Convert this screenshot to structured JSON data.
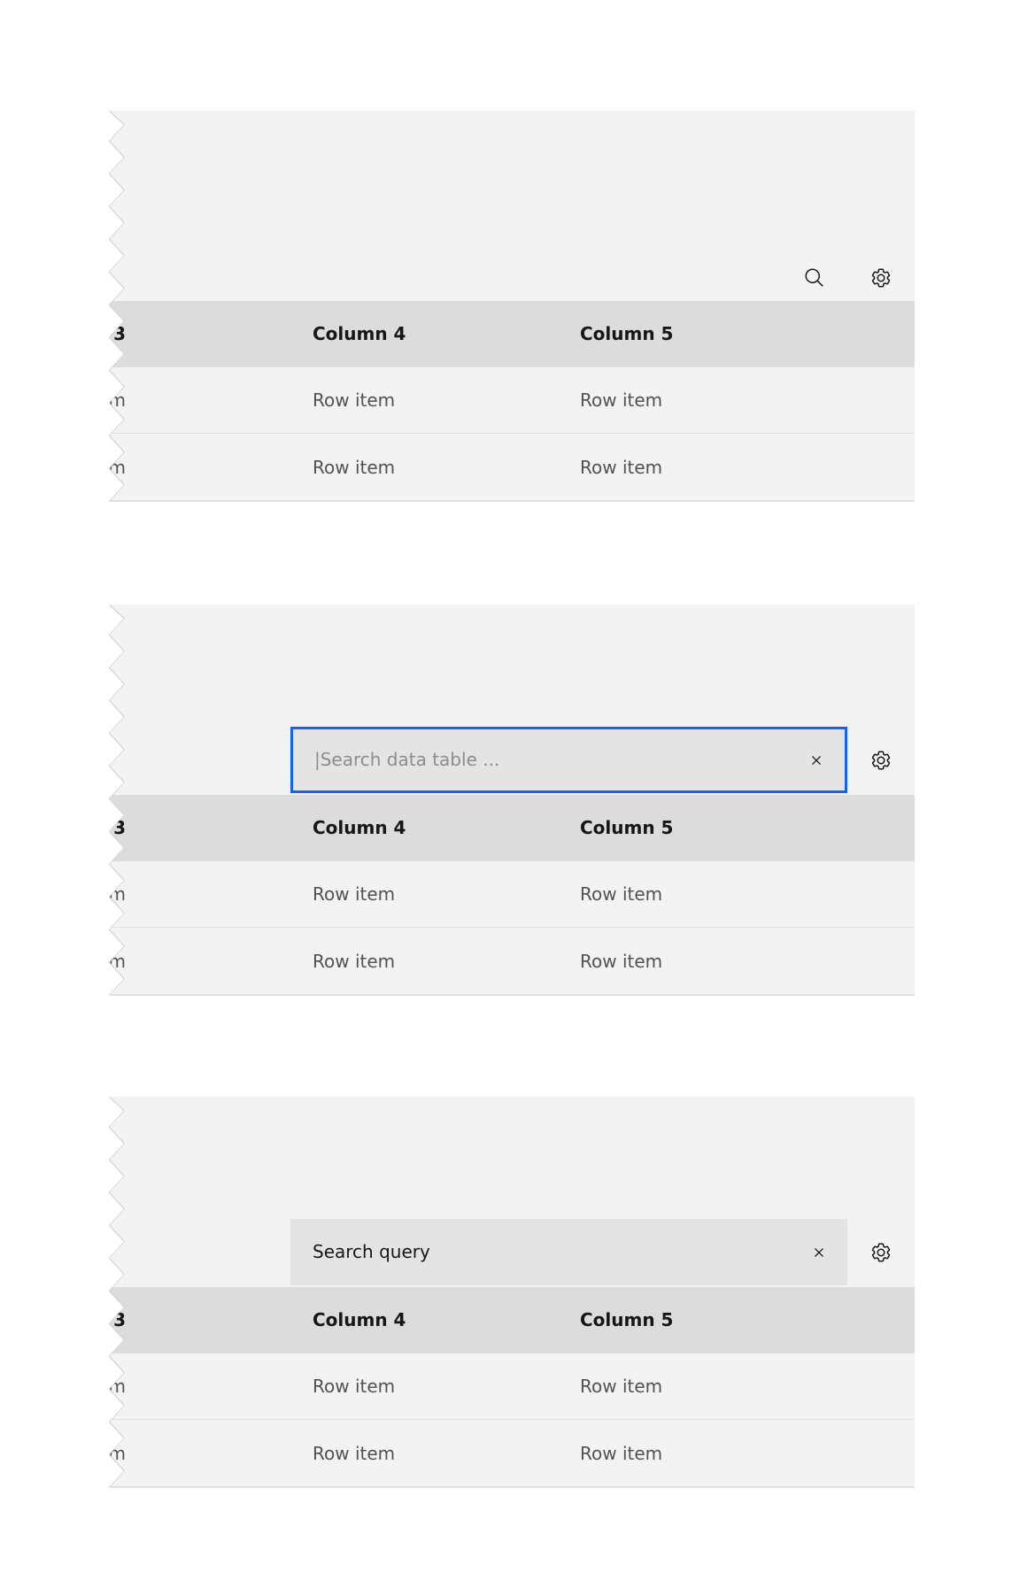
{
  "columns": {
    "c3_fragment": "3",
    "c4": "Column 4",
    "c5": "Column 5"
  },
  "row_fragment": "m",
  "row_item": "Row item",
  "search": {
    "placeholder": "|Search data table ...",
    "query": "Search query"
  },
  "colors": {
    "focus": "#0f62fe",
    "toolbar": "#f3f3f3",
    "header": "#dcdcdc",
    "search_field": "#e4e4e4"
  },
  "icons": [
    "search-icon",
    "settings-gear-icon",
    "close-icon"
  ]
}
